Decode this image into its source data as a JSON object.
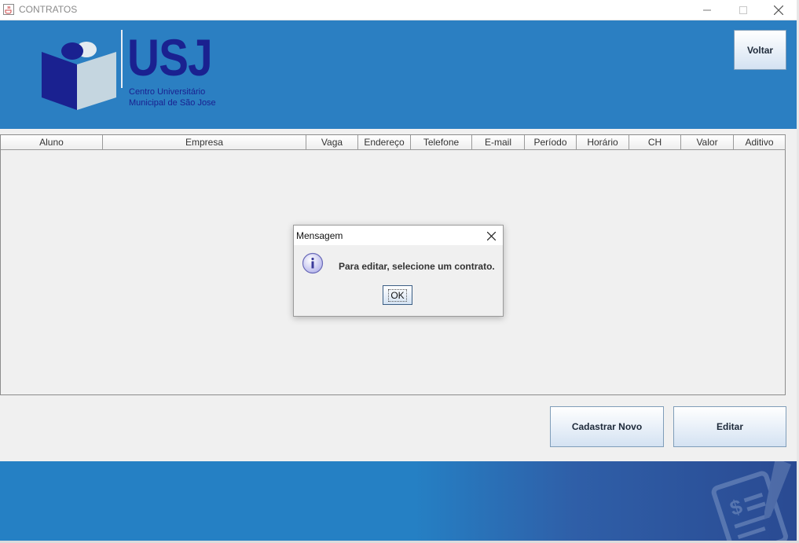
{
  "window": {
    "title": "CONTRATOS",
    "icons": {
      "app": "java-cup-icon",
      "minimize": "minimize-icon",
      "maximize": "maximize-icon",
      "close": "close-icon"
    }
  },
  "header": {
    "logo_text": "USJ",
    "logo_subtitle_1": "Centro Universitário",
    "logo_subtitle_2": "Municipal de São Jose",
    "back_button": "Voltar",
    "brand_color": "#1a2190",
    "background_color": "#2b7fc2"
  },
  "table": {
    "columns": [
      "Aluno",
      "Empresa",
      "Vaga",
      "Endereço",
      "Telefone",
      "E-mail",
      "Período",
      "Horário",
      "CH",
      "Valor",
      "Aditivo"
    ],
    "rows": []
  },
  "actions": {
    "register_button": "Cadastrar Novo",
    "edit_button": "Editar"
  },
  "dialog": {
    "title": "Mensagem",
    "message": "Para editar, selecione um contrato.",
    "ok_button": "OK",
    "icon": "info-icon"
  }
}
